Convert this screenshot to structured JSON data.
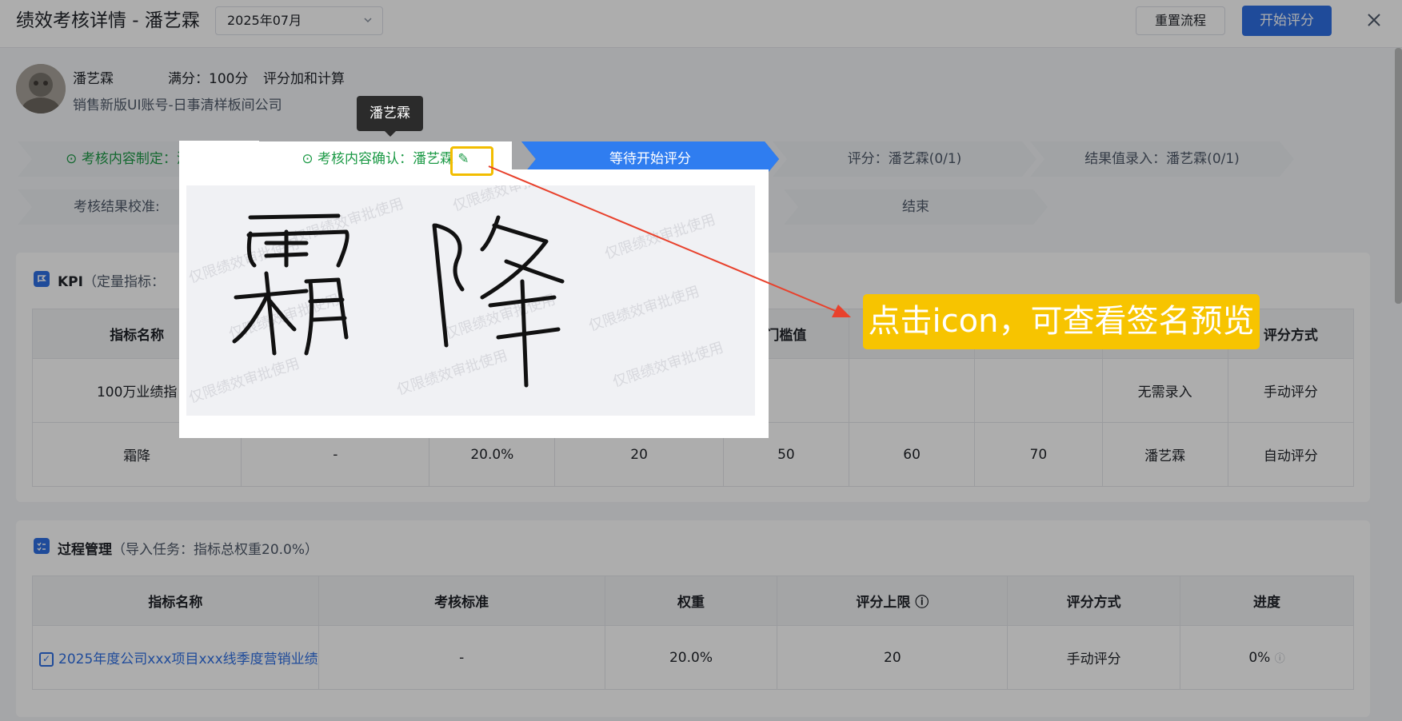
{
  "header": {
    "title": "绩效考核详情 - 潘艺霖",
    "month": "2025年07月",
    "reset_label": "重置流程",
    "start_label": "开始评分"
  },
  "profile": {
    "name": "潘艺霖",
    "full_score": "满分：100分",
    "calc": "评分加和计算",
    "company": "销售新版UI账号-日事清样板间公司"
  },
  "steps": [
    {
      "label": "考核内容制定：潘艺霖",
      "status": "done"
    },
    {
      "label": "考核内容确认：潘艺霖",
      "status": "done"
    },
    {
      "label": "等待开始评分",
      "status": "current"
    },
    {
      "label": "评分：潘艺霖(0/1)",
      "status": "pending"
    },
    {
      "label": "结果值录入：潘艺霖(0/1)",
      "status": "pending"
    },
    {
      "label": "考核结果校准:",
      "status": "pending"
    },
    {
      "label": "结束",
      "status": "pending"
    }
  ],
  "kpi": {
    "title": "KPI",
    "subtitle": "（定量指标：",
    "headers": [
      "指标名称",
      "门槛值",
      "评分方式"
    ],
    "rows": [
      {
        "name": "100万业绩指",
        "cells": [
          "",
          "",
          "",
          "",
          "",
          "",
          "",
          "无需录入",
          "手动评分"
        ]
      },
      {
        "name": "霜降",
        "cells": [
          "-",
          "20.0%",
          "20",
          "50",
          "60",
          "70",
          "潘艺霖",
          "自动评分"
        ]
      }
    ]
  },
  "process": {
    "title": "过程管理",
    "subtitle": "（导入任务：指标总权重20.0%）",
    "headers": [
      "指标名称",
      "考核标准",
      "权重",
      "评分上限",
      "评分方式",
      "进度"
    ],
    "row": {
      "name": "2025年度公司xxx项目xxx线季度营销业绩",
      "standard": "-",
      "weight": "20.0%",
      "limit": "20",
      "method": "手动评分",
      "progress": "0%"
    }
  },
  "tooltip": "潘艺霖",
  "watermark": "仅限绩效审批使用",
  "signature_chars": "霜降",
  "callout": "点击icon，可查看签名预览",
  "colors": {
    "primary": "#2f6fe4",
    "done": "#1c9a46",
    "callout": "#f7c400",
    "arrow": "#e8412c"
  },
  "icons": {
    "done": "check-circle-icon",
    "edit": "pen-icon",
    "close": "close-icon",
    "info": "info-icon",
    "kpi": "flag-icon",
    "process": "checklist-icon"
  }
}
